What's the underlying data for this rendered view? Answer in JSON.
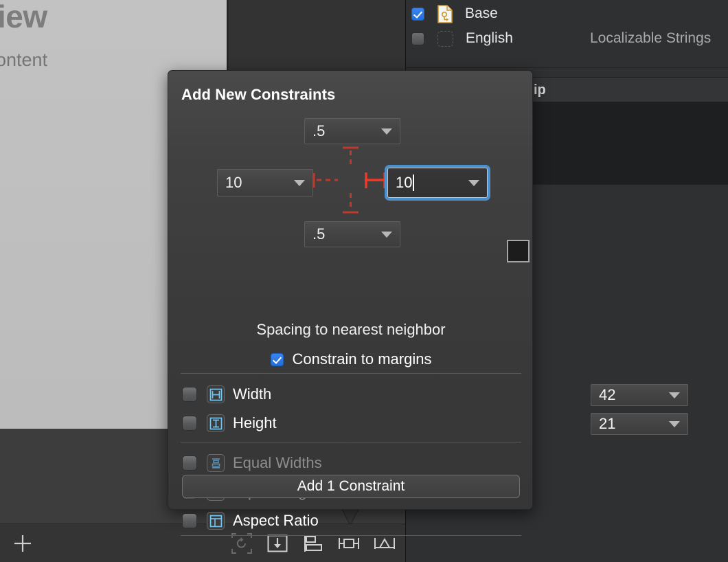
{
  "canvas": {
    "title_fragment": "iew",
    "subtitle_fragment": "ontent"
  },
  "localization_panel": {
    "rows": [
      {
        "label": "Base",
        "checked": true,
        "icon": "document-icon",
        "type": ""
      },
      {
        "label": "English",
        "checked": false,
        "icon": "dashed-placeholder-icon",
        "type": "Localizable Strings"
      }
    ],
    "section_header": "ip"
  },
  "popover": {
    "title": "Add New Constraints",
    "spacing": {
      "top_value": ".5",
      "leading_value": "10",
      "trailing_value": "10",
      "bottom_value": ".5",
      "trailing_focused": true,
      "caption": "Spacing to nearest neighbor",
      "active_edge": "trailing"
    },
    "constrain_to_margins": {
      "label": "Constrain to margins",
      "checked": true
    },
    "size_options": [
      {
        "label": "Width",
        "checked": false,
        "enabled": true,
        "icon": "width-constraint-icon",
        "value": "42"
      },
      {
        "label": "Height",
        "checked": false,
        "enabled": true,
        "icon": "height-constraint-icon",
        "value": "21"
      }
    ],
    "relation_options": [
      {
        "label": "Equal Widths",
        "checked": false,
        "enabled": false,
        "icon": "equal-widths-icon"
      },
      {
        "label": "Equal Heights",
        "checked": false,
        "enabled": false,
        "icon": "equal-heights-icon"
      },
      {
        "label": "Aspect Ratio",
        "checked": false,
        "enabled": true,
        "icon": "aspect-ratio-icon"
      }
    ],
    "add_button_label": "Add 1 Constraint"
  },
  "toolbar": {
    "items": [
      {
        "name": "add-item-button",
        "icon": "plus-icon",
        "enabled": true
      },
      {
        "name": "update-frames-button",
        "icon": "update-frames-icon",
        "enabled": false
      },
      {
        "name": "add-new-constraints-button",
        "icon": "pin-constraints-icon",
        "enabled": true
      },
      {
        "name": "align-button",
        "icon": "align-icon",
        "enabled": true
      },
      {
        "name": "embed-in-button",
        "icon": "embed-icon",
        "enabled": true
      },
      {
        "name": "resolve-issues-button",
        "icon": "resolve-issues-icon",
        "enabled": true
      }
    ]
  },
  "colors": {
    "accent_blue": "#2f7ce0",
    "focus_ring": "#4b90cc",
    "constraint_red": "#e03c2f",
    "icon_cyan": "#73c5f0"
  }
}
